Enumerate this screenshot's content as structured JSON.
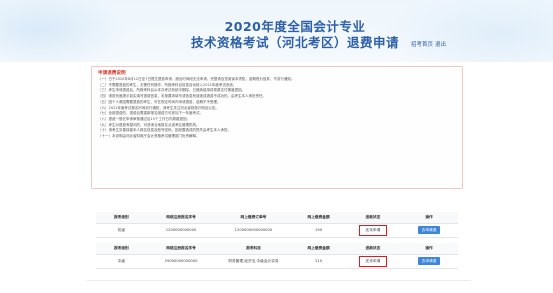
{
  "header": {
    "title_line1": "2020年度全国会计专业",
    "title_line2": "技术资格考试（河北考区）退费申请",
    "nav_home": "招考首页",
    "nav_logout": "退出"
  },
  "notice": {
    "title": "申请退费说明",
    "lines": [
      "（一）日于2020年8月12日至7日提交退费申请，超出时间段无法申请，完整请自觉阅读本须知，逾期视为放弃，不另行通知。",
      "（二）不需要退费的考生，无需任何操作，所报考科目信息自动转入2021年度考试系统。",
      "（三）考生申请退费后，所报考科目从本次考试系统中删除，已缴纳费用将按原支付渠道退回。",
      "（四）请按页面提示如实填写退费信息，未按要求填写或信息有误造成退费不成功的，由考生本人承担责任。",
      "（五）因个人原因需要退费的考生，可在规定时间内申请退费，逾期不予受理。",
      "（六）2021年度考试报名时间另行通知，请考生关注河北省财政厅网站公告。",
      "（七）全部退费的，退费后需重新报名缴费方可参加下一年度考试。",
      "（八）退费一般在申请审核通过后15个工作日内原路退回。",
      "（九）考生对退费有疑问的，可咨询当地报名点或考区管理机构。",
      "（十）请考生妥善保管本人报名信息及账号密码，因泄露造成的损失由考生本人承担。",
      "（十一）本说明由河北省财政厅会计资格考试管理部门负责解释。"
    ]
  },
  "tables": [
    {
      "headers": [
        "报考级别",
        "网络注册报名序号",
        "网上缴费订单号",
        "网上缴费金额",
        "退款状态",
        "操作"
      ],
      "rows": [
        {
          "level": "初级",
          "reg_no": "1200000000000",
          "order_no": "1200000000000000",
          "amount": "190",
          "status": "还未申请",
          "action": "去申请退"
        }
      ]
    },
    {
      "headers": [
        "报考级别",
        "网络注册报名序号",
        "报考科目",
        "网上缴费金额",
        "退款状态",
        "操作"
      ],
      "rows": [
        {
          "level": "中级",
          "reg_no": "29000000000000",
          "order_no": "财务管理,经济法,中级会计实务",
          "amount": "210",
          "status": "还未申请",
          "action": "去申请退"
        }
      ]
    }
  ],
  "colors": {
    "title": "#2d5fa8",
    "status_border": "#e0191a",
    "button": "#3d86d8",
    "notice_title": "#d8332a"
  }
}
